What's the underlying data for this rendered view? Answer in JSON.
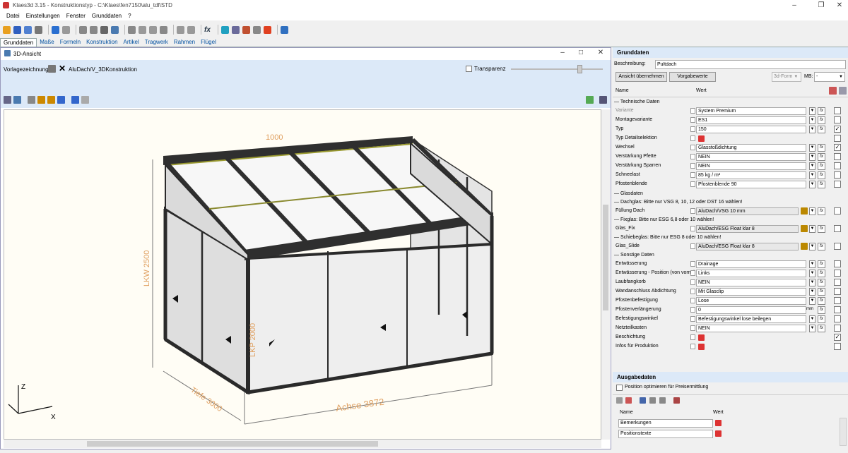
{
  "window": {
    "title": "Klaes3d 3.15 - Konstruktionstyp - C:\\Klaes\\fen7150\\alu_tdf\\STD"
  },
  "menu": [
    "Datei",
    "Einstellungen",
    "Fenster",
    "Grunddaten",
    "?"
  ],
  "tabs": [
    "Grunddaten",
    "Maße",
    "Formeln",
    "Konstruktion",
    "Artikel",
    "Tragwerk",
    "Rahmen",
    "Flügel"
  ],
  "view3d": {
    "title": "3D-Ansicht",
    "template_label": "Vorlagezeichnung:",
    "template_value": "AluDach/V_3DKonstruktion",
    "transparency_label": "Transparenz",
    "dims": {
      "width_top": "1000",
      "lkw": "LKW 2500",
      "lkp": "LKP 2000",
      "depth": "Tiefe 3000",
      "axis": "Achse 3872"
    },
    "axis_z": "Z",
    "axis_x": "X"
  },
  "grunddaten": {
    "title": "Grunddaten",
    "desc_label": "Beschreibung:",
    "desc_value": "Pultdach",
    "btn_apply": "Ansicht übernehmen",
    "btn_defaults": "Vorgabewerte",
    "form_3d": "3d-Form",
    "mb_label": "MB:",
    "mb_value": "-",
    "col_name": "Name",
    "col_value": "Wert",
    "groups": {
      "tech": "Technische Daten",
      "glass": "Glasdaten",
      "roof_note": "Dachglas: Bitte nur VSG 8, 10, 12 oder DST 16 wählen!",
      "fix_note": "Fixglas: Bitte nur ESG 6,8 oder 10 wählen!",
      "slide_note": "Schiebeglas: Bitte nur ESG 8 oder 10 wählen!",
      "other": "Sonstige Daten"
    },
    "rows_tech": [
      {
        "name": "Variante",
        "value": "System Premium",
        "checked": false,
        "dim": true
      },
      {
        "name": "Montagevariante",
        "value": "ES1",
        "checked": false
      },
      {
        "name": "Typ",
        "value": "150",
        "checked": true
      },
      {
        "name": "Typ Detailselektion",
        "value": "",
        "checked": false
      },
      {
        "name": "Wechsel",
        "value": "Glasstoßdichtung",
        "checked": true
      },
      {
        "name": "Verstärkung Pfette",
        "value": "NEIN",
        "checked": false
      },
      {
        "name": "Verstärkung Sparren",
        "value": "NEIN",
        "checked": false
      },
      {
        "name": "Schneelast",
        "value": "85 kg / m²",
        "checked": false
      },
      {
        "name": "Pfostenblende",
        "value": "Pfostenblende 90",
        "checked": false
      }
    ],
    "row_roof": {
      "name": "Füllung Dach",
      "value": "AluDach/VSG 10 mm"
    },
    "row_fix": {
      "name": "Glas_Fix",
      "value": "AluDach/ESG Float klar 8"
    },
    "row_slide": {
      "name": "Glas_Slide",
      "value": "AluDach/ESG Float klar 8"
    },
    "rows_other": [
      {
        "name": "Entwässerung",
        "value": "Drainage",
        "checked": false
      },
      {
        "name": "Entwässerung - Position (von vorne)",
        "value": "Links",
        "checked": false
      },
      {
        "name": "Laubfangkorb",
        "value": "NEIN",
        "checked": false
      },
      {
        "name": "Wandanschluss Abdichtung",
        "value": "Mit Glasclip",
        "checked": false
      },
      {
        "name": "Pfostenbefestigung",
        "value": "Lose",
        "checked": false
      },
      {
        "name": "Pfostenverlängerung",
        "value": "0",
        "unit": "mm",
        "checked": false
      },
      {
        "name": "Befestigungswinkel",
        "value": "Befestigungswinkel lose beilegen",
        "checked": false
      },
      {
        "name": "Netzteilkasten",
        "value": "NEIN",
        "checked": false
      },
      {
        "name": "Beschichtung",
        "value": "",
        "checked": true
      },
      {
        "name": "Infos für Produktion",
        "value": "",
        "checked": false
      }
    ]
  },
  "ausgabe": {
    "title": "Ausgabedaten",
    "optimize_label": "Position optimieren für Preisermittlung",
    "col_name": "Name",
    "col_value": "Wert",
    "rows": [
      "Bemerkungen",
      "Positionstexte"
    ]
  }
}
